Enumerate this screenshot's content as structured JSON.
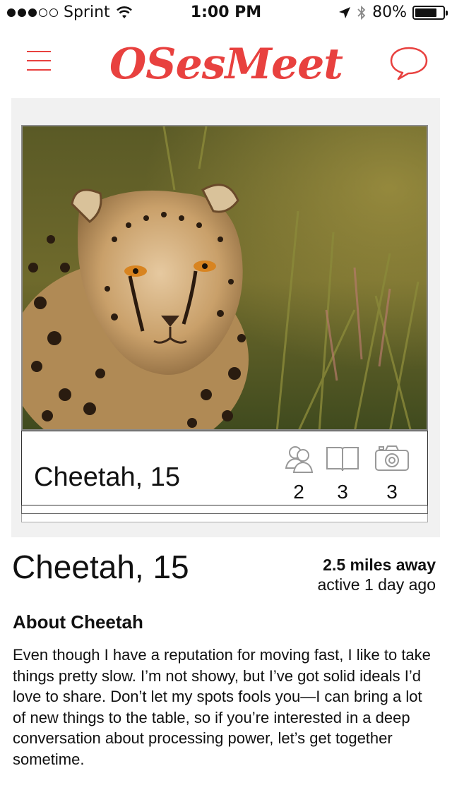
{
  "status_bar": {
    "carrier": "Sprint",
    "time": "1:00 PM",
    "battery": "80%",
    "battery_level": 0.8,
    "signal_bars_filled": 3,
    "signal_bars_total": 5
  },
  "header": {
    "logo": "OSesMeet",
    "menu_icon": "hamburger-icon",
    "chat_icon": "speech-bubble-icon",
    "accent_color": "#e8413f"
  },
  "card": {
    "name_age": "Cheetah, 15",
    "stats": [
      {
        "icon": "friends-icon",
        "count": "2"
      },
      {
        "icon": "book-icon",
        "count": "3"
      },
      {
        "icon": "camera-icon",
        "count": "3"
      }
    ]
  },
  "profile": {
    "name_age": "Cheetah, 15",
    "distance": "2.5 miles away",
    "active": "active 1 day ago",
    "about_title": "About Cheetah",
    "about_text": "Even though I have a reputation for moving fast, I like to take things pretty slow. I’m not showy, but I’ve got solid ideals I’d love to share. Don’t let my spots fools you—I can bring a lot of new things to the table, so if you’re interested in a deep conversation about processing power, let’s get together sometime."
  }
}
